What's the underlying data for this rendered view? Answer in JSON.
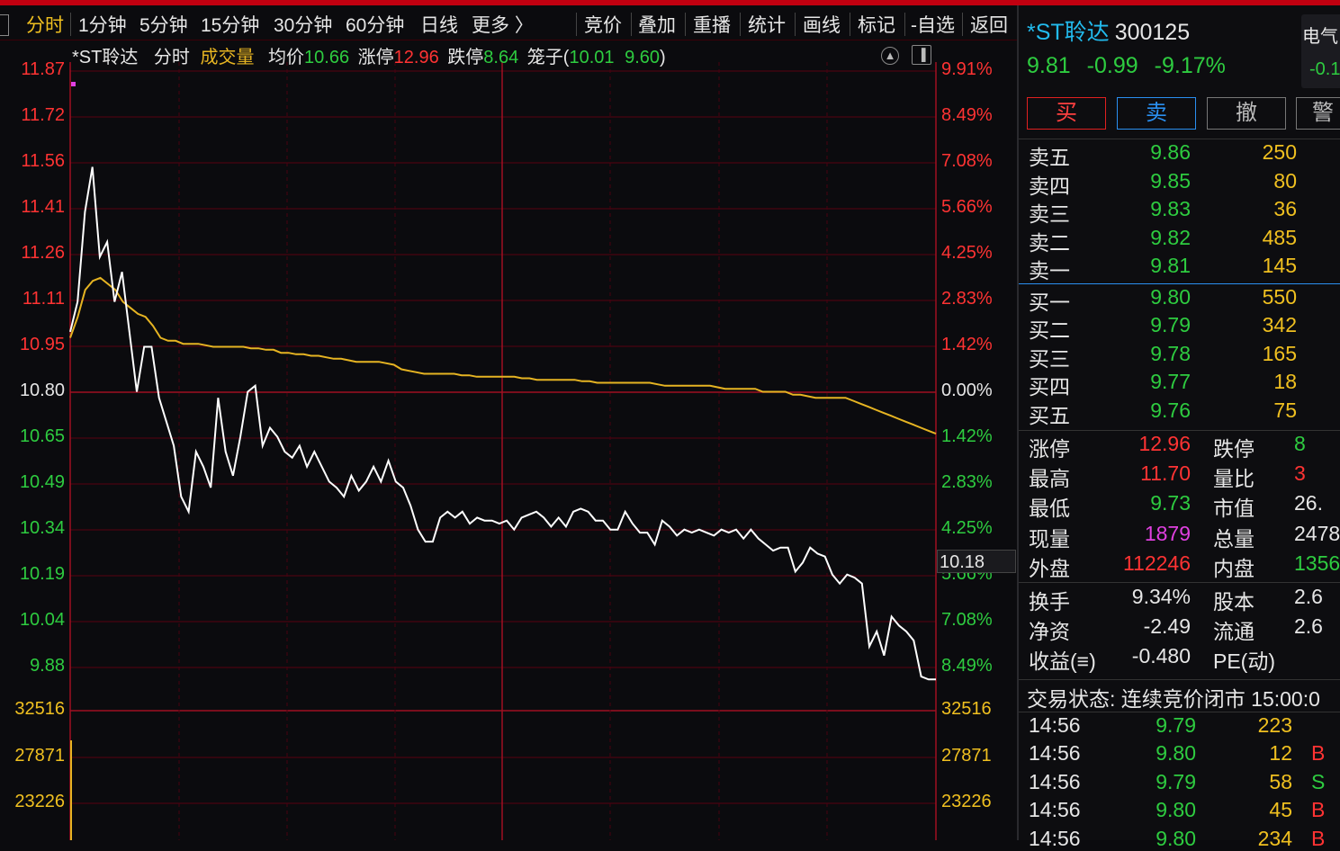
{
  "toolbar": {
    "tabs": [
      "分时",
      "1分钟",
      "5分钟",
      "15分钟",
      "30分钟",
      "60分钟",
      "日线",
      "更多 〉"
    ],
    "actions": [
      "竞价",
      "叠加",
      "重播",
      "统计",
      "画线",
      "标记",
      "-自选",
      "返回"
    ]
  },
  "chart_info": {
    "stock": "*ST聆达",
    "mode": "分时",
    "volume_label": "成交量",
    "avg_label": "均价",
    "avg_value": "10.66",
    "limit_up_label": "涨停",
    "limit_up_value": "12.96",
    "limit_down_label": "跌停",
    "limit_down_value": "8.64",
    "cage_label": "笼子(",
    "cage_value1": "10.01",
    "cage_value2": "9.60",
    "cage_close": ")"
  },
  "price_axis": [
    "11.87",
    "11.72",
    "11.56",
    "11.41",
    "11.26",
    "11.11",
    "10.95",
    "10.80",
    "10.65",
    "10.49",
    "10.34",
    "10.19",
    "10.04",
    "9.88"
  ],
  "pct_axis": [
    "9.91%",
    "8.49%",
    "7.08%",
    "5.66%",
    "4.25%",
    "2.83%",
    "1.42%",
    "0.00%",
    "1.42%",
    "2.83%",
    "4.25%",
    "5.66%",
    "7.08%",
    "8.49%"
  ],
  "volume_axis": [
    "32516",
    "27871",
    "23226"
  ],
  "cursor_value": "10.18",
  "chart_data": {
    "type": "line",
    "title": "",
    "xlabel": "",
    "ylabel": "",
    "ylim": [
      9.73,
      11.87
    ],
    "reference_price": 10.8,
    "series": [
      {
        "values": [
          11.0,
          11.1,
          11.4,
          11.55,
          11.25,
          11.3,
          11.1,
          11.2,
          11.0,
          10.8,
          10.95,
          10.95,
          10.78,
          10.7,
          10.62,
          10.45,
          10.4,
          10.6,
          10.55,
          10.48,
          10.78,
          10.6,
          10.52,
          10.65,
          10.8,
          10.82,
          10.62,
          10.68,
          10.65,
          10.6,
          10.58,
          10.62,
          10.55,
          10.6,
          10.55,
          10.5,
          10.48,
          10.45,
          10.52,
          10.47,
          10.5,
          10.55,
          10.5,
          10.57,
          10.5,
          10.48,
          10.42,
          10.34,
          10.3,
          10.3,
          10.38,
          10.4,
          10.38,
          10.4,
          10.36,
          10.38,
          10.37,
          10.37,
          10.36,
          10.37,
          10.34,
          10.38,
          10.39,
          10.4,
          10.38,
          10.35,
          10.38,
          10.35,
          10.4,
          10.41,
          10.4,
          10.37,
          10.37,
          10.34,
          10.34,
          10.4,
          10.36,
          10.33,
          10.33,
          10.29,
          10.37,
          10.35,
          10.32,
          10.34,
          10.33,
          10.34,
          10.33,
          10.32,
          10.34,
          10.33,
          10.34,
          10.31,
          10.34,
          10.31,
          10.29,
          10.27,
          10.28,
          10.28,
          10.2,
          10.23,
          10.28,
          10.26,
          10.25,
          10.19,
          10.16,
          10.19,
          10.18,
          10.16,
          9.95,
          10.0,
          9.92,
          10.05,
          10.02,
          10.0,
          9.97,
          9.85,
          9.84,
          9.84
        ],
        "color": "#ffffff"
      },
      {
        "values": [
          10.98,
          11.05,
          11.14,
          11.17,
          11.18,
          11.16,
          11.14,
          11.1,
          11.08,
          11.06,
          11.05,
          11.02,
          10.98,
          10.97,
          10.97,
          10.96,
          10.96,
          10.96,
          10.955,
          10.95,
          10.95,
          10.95,
          10.95,
          10.95,
          10.945,
          10.945,
          10.94,
          10.94,
          10.93,
          10.93,
          10.925,
          10.925,
          10.92,
          10.92,
          10.915,
          10.91,
          10.91,
          10.905,
          10.9,
          10.9,
          10.9,
          10.9,
          10.895,
          10.89,
          10.875,
          10.87,
          10.865,
          10.86,
          10.86,
          10.86,
          10.86,
          10.86,
          10.855,
          10.855,
          10.85,
          10.85,
          10.85,
          10.85,
          10.85,
          10.85,
          10.845,
          10.845,
          10.84,
          10.84,
          10.84,
          10.84,
          10.84,
          10.84,
          10.835,
          10.835,
          10.83,
          10.83,
          10.83,
          10.83,
          10.83,
          10.83,
          10.83,
          10.83,
          10.825,
          10.82,
          10.82,
          10.82,
          10.82,
          10.82,
          10.82,
          10.82,
          10.815,
          10.81,
          10.81,
          10.81,
          10.81,
          10.81,
          10.8,
          10.8,
          10.8,
          10.8,
          10.79,
          10.79,
          10.785,
          10.78,
          10.78,
          10.78,
          10.78,
          10.78,
          10.77,
          10.76,
          10.75,
          10.74,
          10.73,
          10.72,
          10.71,
          10.7,
          10.69,
          10.68,
          10.67,
          10.66
        ],
        "color": "#e6b422"
      }
    ]
  },
  "right_panel": {
    "name": "*ST聆达",
    "code": "300125",
    "price": "9.81",
    "change": "-0.99",
    "change_pct": "-9.17%",
    "sector_name": "电气",
    "sector_change": "-0.1",
    "buttons": {
      "buy": "买",
      "sell": "卖",
      "cancel": "撤",
      "alert": "警"
    },
    "asks": [
      {
        "label": "卖五",
        "price": "9.86",
        "vol": "250"
      },
      {
        "label": "卖四",
        "price": "9.85",
        "vol": "80"
      },
      {
        "label": "卖三",
        "price": "9.83",
        "vol": "36"
      },
      {
        "label": "卖二",
        "price": "9.82",
        "vol": "485"
      },
      {
        "label": "卖一",
        "price": "9.81",
        "vol": "145"
      }
    ],
    "bids": [
      {
        "label": "买一",
        "price": "9.80",
        "vol": "550"
      },
      {
        "label": "买二",
        "price": "9.79",
        "vol": "342"
      },
      {
        "label": "买三",
        "price": "9.78",
        "vol": "165"
      },
      {
        "label": "买四",
        "price": "9.77",
        "vol": "18"
      },
      {
        "label": "买五",
        "price": "9.76",
        "vol": "75"
      }
    ],
    "stats": [
      {
        "label": "涨停",
        "value": "12.96",
        "label2": "跌停",
        "value2": "8"
      },
      {
        "label": "最高",
        "value": "11.70",
        "label2": "量比",
        "value2": "3"
      },
      {
        "label": "最低",
        "value": "9.73",
        "label2": "市值",
        "value2": "26."
      },
      {
        "label": "现量",
        "value": "1879",
        "label2": "总量",
        "value2": "2478"
      },
      {
        "label": "外盘",
        "value": "112246",
        "label2": "内盘",
        "value2": "1356"
      }
    ],
    "stats2": [
      {
        "label": "换手",
        "value": "9.34%",
        "label2": "股本",
        "value2": "2.6"
      },
      {
        "label": "净资",
        "value": "-2.49",
        "label2": "流通",
        "value2": "2.6"
      },
      {
        "label": "收益(≡)",
        "value": "-0.480",
        "label2": "PE(动)",
        "value2": ""
      }
    ],
    "trade_status": "交易状态: 连续竞价闭市 15:00:0",
    "trades": [
      {
        "time": "14:56",
        "price": "9.79",
        "vol": "223",
        "side": ""
      },
      {
        "time": "14:56",
        "price": "9.80",
        "vol": "12",
        "side": "B"
      },
      {
        "time": "14:56",
        "price": "9.79",
        "vol": "58",
        "side": "S"
      },
      {
        "time": "14:56",
        "price": "9.80",
        "vol": "45",
        "side": "B"
      },
      {
        "time": "14:56",
        "price": "9.80",
        "vol": "234",
        "side": "B"
      }
    ]
  }
}
